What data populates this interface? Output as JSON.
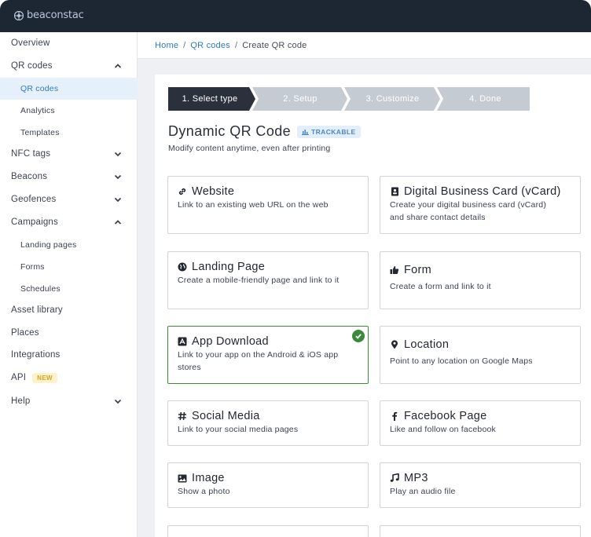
{
  "app": {
    "logo_text": "beaconstac"
  },
  "sidebar": {
    "items": [
      {
        "label": "Overview"
      },
      {
        "label": "QR codes",
        "expanded": true
      },
      {
        "label": "QR codes",
        "active": true
      },
      {
        "label": "Analytics"
      },
      {
        "label": "Templates"
      },
      {
        "label": "NFC tags",
        "expanded": false
      },
      {
        "label": "Beacons",
        "expanded": false
      },
      {
        "label": "Geofences",
        "expanded": false
      },
      {
        "label": "Campaigns",
        "expanded": true
      },
      {
        "label": "Landing pages"
      },
      {
        "label": "Forms"
      },
      {
        "label": "Schedules"
      },
      {
        "label": "Asset library"
      },
      {
        "label": "Places"
      },
      {
        "label": "Integrations"
      },
      {
        "label": "API",
        "badge": "NEW"
      },
      {
        "label": "Help",
        "expanded": false
      }
    ]
  },
  "breadcrumb": {
    "home": "Home",
    "qr_codes": "QR codes",
    "current": "Create QR code",
    "sep": "/"
  },
  "stepper": {
    "steps": [
      {
        "label": "1. Select type",
        "active": true
      },
      {
        "label": "2. Setup"
      },
      {
        "label": "3. Customize"
      },
      {
        "label": "4. Done"
      }
    ]
  },
  "main": {
    "title": "Dynamic QR Code",
    "badge": "TRACKABLE",
    "subtitle": "Modify content anytime, even after printing"
  },
  "options": [
    {
      "title": "Website",
      "desc": "Link to an existing web URL on the web",
      "icon": "link-icon"
    },
    {
      "title": "Digital Business Card (vCard)",
      "desc": "Create your digital business card (vCard) and share contact details",
      "icon": "contact-card-icon"
    },
    {
      "title": "Landing Page",
      "desc": "Create a mobile-friendly page and link to it",
      "icon": "globe-icon"
    },
    {
      "title": "Form",
      "desc": "Create a form and link to it",
      "icon": "thumbs-up-icon"
    },
    {
      "title": "App Download",
      "desc": "Link to your app on the Android & iOS app stores",
      "icon": "app-store-icon",
      "selected": true
    },
    {
      "title": "Location",
      "desc": "Point to any location on Google Maps",
      "icon": "map-pin-icon"
    },
    {
      "title": "Social Media",
      "desc": "Link to your social media pages",
      "icon": "hashtag-icon"
    },
    {
      "title": "Facebook Page",
      "desc": "Like and follow on facebook",
      "icon": "facebook-icon"
    },
    {
      "title": "Image",
      "desc": "Show a photo",
      "icon": "image-icon"
    },
    {
      "title": "MP3",
      "desc": "Play an audio file",
      "icon": "music-note-icon"
    }
  ],
  "colors": {
    "topbar": "#1d2633",
    "link": "#2f79c7",
    "step_active": "#2b313c",
    "step_inactive": "#c5cbd3",
    "selected_border": "#3a8a3a",
    "new_badge_bg": "#fdf2cc"
  }
}
